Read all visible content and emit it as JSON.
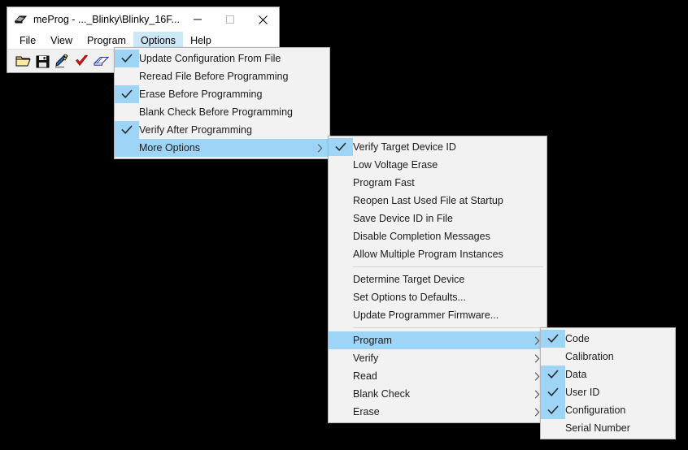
{
  "window": {
    "title": "meProg - ..._Blinky\\Blinky_16F...",
    "icon": "chip-icon",
    "controls": {
      "minimize_label": "—",
      "maximize_label": "☐",
      "close_label": "✕"
    }
  },
  "menubar": {
    "items": [
      {
        "label": "File",
        "active": false
      },
      {
        "label": "View",
        "active": false
      },
      {
        "label": "Program",
        "active": false
      },
      {
        "label": "Options",
        "active": true
      },
      {
        "label": "Help",
        "active": false
      }
    ]
  },
  "toolbar": {
    "buttons": [
      {
        "name": "open-file-icon",
        "title": "Open"
      },
      {
        "name": "save-file-icon",
        "title": "Save"
      },
      {
        "name": "write-device-icon",
        "title": "Program device"
      },
      {
        "name": "verify-check-icon",
        "title": "Verify"
      },
      {
        "name": "read-device-icon",
        "title": "Read"
      },
      {
        "name": "blank-check-icon",
        "title": "Blank check"
      }
    ]
  },
  "menus": {
    "options": {
      "name": "options-menu",
      "items": [
        {
          "label": "Update Configuration From File",
          "checked": true,
          "highlight": false,
          "submenu": false
        },
        {
          "label": "Reread File Before Programming",
          "checked": false,
          "highlight": false,
          "submenu": false
        },
        {
          "label": "Erase Before Programming",
          "checked": true,
          "highlight": false,
          "submenu": false
        },
        {
          "label": "Blank Check Before Programming",
          "checked": false,
          "highlight": false,
          "submenu": false
        },
        {
          "label": "Verify After Programming",
          "checked": true,
          "highlight": false,
          "submenu": false
        },
        {
          "label": "More Options",
          "checked": false,
          "highlight": true,
          "submenu": true
        }
      ]
    },
    "more_options": {
      "name": "more-options-submenu",
      "items": [
        {
          "type": "item",
          "label": "Verify Target Device ID",
          "checked": true,
          "highlight": false,
          "submenu": false
        },
        {
          "type": "item",
          "label": "Low Voltage Erase",
          "checked": false,
          "highlight": false,
          "submenu": false
        },
        {
          "type": "item",
          "label": "Program Fast",
          "checked": false,
          "highlight": false,
          "submenu": false
        },
        {
          "type": "item",
          "label": "Reopen Last Used File at Startup",
          "checked": false,
          "highlight": false,
          "submenu": false
        },
        {
          "type": "item",
          "label": "Save Device ID in File",
          "checked": false,
          "highlight": false,
          "submenu": false
        },
        {
          "type": "item",
          "label": "Disable Completion Messages",
          "checked": false,
          "highlight": false,
          "submenu": false
        },
        {
          "type": "item",
          "label": "Allow Multiple Program Instances",
          "checked": false,
          "highlight": false,
          "submenu": false
        },
        {
          "type": "separator"
        },
        {
          "type": "item",
          "label": "Determine Target Device",
          "checked": false,
          "highlight": false,
          "submenu": false
        },
        {
          "type": "item",
          "label": "Set Options to Defaults...",
          "checked": false,
          "highlight": false,
          "submenu": false
        },
        {
          "type": "item",
          "label": "Update Programmer Firmware...",
          "checked": false,
          "highlight": false,
          "submenu": false
        },
        {
          "type": "separator"
        },
        {
          "type": "item",
          "label": "Program",
          "checked": false,
          "highlight": true,
          "submenu": true
        },
        {
          "type": "item",
          "label": "Verify",
          "checked": false,
          "highlight": false,
          "submenu": true
        },
        {
          "type": "item",
          "label": "Read",
          "checked": false,
          "highlight": false,
          "submenu": true
        },
        {
          "type": "item",
          "label": "Blank Check",
          "checked": false,
          "highlight": false,
          "submenu": true
        },
        {
          "type": "item",
          "label": "Erase",
          "checked": false,
          "highlight": false,
          "submenu": true
        }
      ]
    },
    "program": {
      "name": "program-submenu",
      "items": [
        {
          "label": "Code",
          "checked": true,
          "highlight": false
        },
        {
          "label": "Calibration",
          "checked": false,
          "highlight": false
        },
        {
          "label": "Data",
          "checked": true,
          "highlight": false
        },
        {
          "label": "User ID",
          "checked": true,
          "highlight": false
        },
        {
          "label": "Configuration",
          "checked": true,
          "highlight": false
        },
        {
          "label": "Serial Number",
          "checked": false,
          "highlight": false
        }
      ]
    }
  },
  "colors": {
    "menu_background": "#f2f2f2",
    "highlight": "#9ed5f7",
    "menubar_active": "#cce8f6",
    "toolbar_background": "#f0f0f0",
    "desktop": "#000000",
    "text": "#1b1b1b"
  }
}
